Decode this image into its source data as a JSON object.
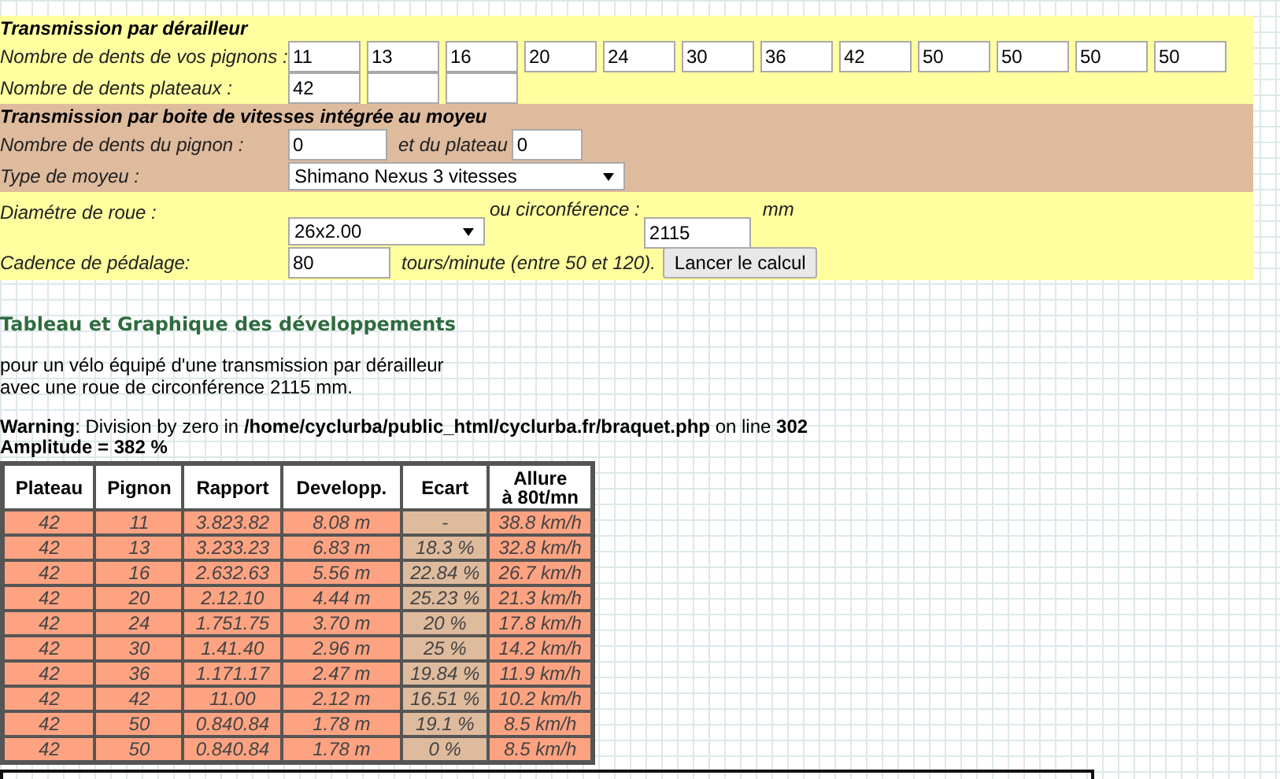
{
  "derailleur": {
    "title": "Transmission par dérailleur",
    "pignons_label": "Nombre de dents de vos pignons :",
    "pignons": [
      "11",
      "13",
      "16",
      "20",
      "24",
      "30",
      "36",
      "42",
      "50",
      "50",
      "50",
      "50"
    ],
    "plateaux_label": "Nombre de dents plateaux :",
    "plateaux": [
      "42"
    ]
  },
  "moyeu": {
    "title": "Transmission par boite de vitesses intégrée au moyeu",
    "pignon_label": "Nombre de dents du pignon :",
    "pignon": "0",
    "plateau_label": "et du plateau",
    "plateau": "0",
    "type_label": "Type de moyeu :",
    "type": "Shimano Nexus 3 vitesses"
  },
  "roue": {
    "diametre_label": "Diamétre de roue :",
    "diametre": "26x2.00",
    "circ_label": "ou circonférence :",
    "circ": "2115",
    "circ_unit": "mm",
    "cadence_label": "Cadence de pédalage:",
    "cadence": "80",
    "cadence_hint": "tours/minute (entre 50 et 120).",
    "button": "Lancer le calcul"
  },
  "results": {
    "title": "Tableau et Graphique des développements",
    "intro": [
      "pour un vélo équipé d'une transmission par dérailleur",
      "avec une roue de circonférence 2115 mm."
    ],
    "warning": "**Warning**: Division by zero in **/home/cyclurba/public_html/cyclurba.fr/braquet.php** on line **302**",
    "amplitude": "Amplitude = 382 %"
  },
  "table": {
    "columns": [
      "Plateau",
      "Pignon",
      "Rapport",
      "Developp.",
      "Ecart",
      "Allure\nà 80t/mn"
    ],
    "rows": [
      [
        "42",
        "11",
        "3.823.82",
        "8.08 m",
        "-",
        "38.8 km/h"
      ],
      [
        "42",
        "13",
        "3.233.23",
        "6.83 m",
        "18.3 %",
        "32.8 km/h"
      ],
      [
        "42",
        "16",
        "2.632.63",
        "5.56 m",
        "22.84 %",
        "26.7 km/h"
      ],
      [
        "42",
        "20",
        "2.12.10",
        "4.44 m",
        "25.23 %",
        "21.3 km/h"
      ],
      [
        "42",
        "24",
        "1.751.75",
        "3.70 m",
        "20 %",
        "17.8 km/h"
      ],
      [
        "42",
        "30",
        "1.41.40",
        "2.96 m",
        "25 %",
        "14.2 km/h"
      ],
      [
        "42",
        "36",
        "1.171.17",
        "2.47 m",
        "19.84 %",
        "11.9 km/h"
      ],
      [
        "42",
        "42",
        "11.00",
        "2.12 m",
        "16.51 %",
        "10.2 km/h"
      ],
      [
        "42",
        "50",
        "0.840.84",
        "1.78 m",
        "19.1 %",
        "8.5 km/h"
      ],
      [
        "42",
        "50",
        "0.840.84",
        "1.78 m",
        "0 %",
        "8.5 km/h"
      ]
    ]
  }
}
